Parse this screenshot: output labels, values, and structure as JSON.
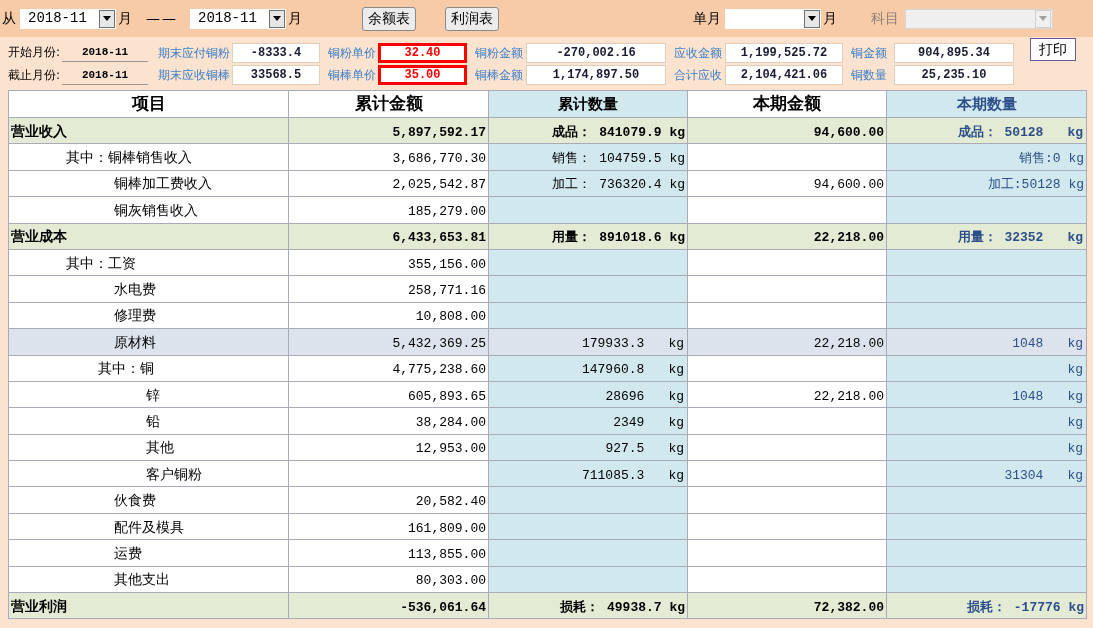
{
  "filter_bar": {
    "from_label": "从",
    "from_month": "2018-11",
    "from_unit": "月",
    "separator": "——",
    "to_month": "2018-11",
    "to_unit": "月",
    "buttons": [
      "余额表",
      "利润表"
    ],
    "single_month_label": "单月",
    "single_month_unit": "月",
    "subject_label": "科目",
    "subject_disabled": true
  },
  "summary": {
    "start_label": "开始月份:",
    "start_value": "2018-11",
    "end_label": "截止月份:",
    "end_value": "2018-11",
    "field_columns": [
      [
        {
          "label": "期末应付铜粉",
          "value": "-8333.4",
          "highlighted": false
        },
        {
          "label": "期末应收铜棒",
          "value": "33568.5",
          "highlighted": false
        }
      ],
      [
        {
          "label": "铜粉单价",
          "value": "32.40",
          "highlighted": true
        },
        {
          "label": "铜棒单价",
          "value": "35.00",
          "highlighted": true
        }
      ],
      [
        {
          "label": "铜粉金额",
          "value": "-270,002.16",
          "highlighted": false
        },
        {
          "label": "铜棒金额",
          "value": "1,174,897.50",
          "highlighted": false
        }
      ],
      [
        {
          "label": "应收金额",
          "value": "1,199,525.72",
          "highlighted": false
        },
        {
          "label": "合计应收",
          "value": "2,104,421.06",
          "highlighted": false
        }
      ],
      [
        {
          "label": "铜金额",
          "value": "904,895.34",
          "highlighted": false
        },
        {
          "label": "铜数量",
          "value": "25,235.10",
          "highlighted": false
        }
      ]
    ],
    "print_button": "打印"
  },
  "table": {
    "columns": [
      "项目",
      "累计金额",
      "累计数量",
      "本期金额",
      "本期数量"
    ],
    "sections": [
      {
        "label": "营业收入",
        "cum_amount": "5,897,592.17",
        "cum_qty": "成品： 841079.9 kg",
        "cur_amount": "94,600.00",
        "cur_qty": "成品： 50128",
        "cur_qty_unit": "kg",
        "children": [
          {
            "prefix": "其中：",
            "label": "铜棒销售收入",
            "cum_amount": "3,686,770.30",
            "cum_qty": "销售： 104759.5 kg",
            "cur_qty": "销售:0 kg"
          },
          {
            "label": "铜棒加工费收入",
            "cum_amount": "2,025,542.87",
            "cum_qty": "加工： 736320.4 kg",
            "cur_amount": "94,600.00",
            "cur_qty": "加工:50128 kg"
          },
          {
            "label": "铜灰销售收入",
            "cum_amount": "185,279.00"
          }
        ]
      },
      {
        "label": "营业成本",
        "cum_amount": "6,433,653.81",
        "cum_qty": "用量： 891018.6 kg",
        "cur_amount": "22,218.00",
        "cur_qty": "用量： 32352",
        "cur_qty_unit": "kg",
        "children": [
          {
            "prefix": "其中：",
            "label": "工资",
            "cum_amount": "355,156.00"
          },
          {
            "label": "水电费",
            "cum_amount": "258,771.16"
          },
          {
            "label": "修理费",
            "cum_amount": "10,808.00"
          },
          {
            "label": "原材料",
            "cum_amount": "5,432,369.25",
            "cum_qty": "179933.3",
            "cum_qty_unit": "kg",
            "cur_amount": "22,218.00",
            "cur_qty": "1048",
            "cur_qty_unit": "kg",
            "children": [
              {
                "prefix": "其中：",
                "label": "铜",
                "cum_amount": "4,775,238.60",
                "cum_qty": "147960.8",
                "cum_qty_unit": "kg",
                "cur_qty_unit": "kg"
              },
              {
                "label": "锌",
                "cum_amount": "605,893.65",
                "cum_qty": "28696",
                "cum_qty_unit": "kg",
                "cur_amount": "22,218.00",
                "cur_qty": "1048",
                "cur_qty_unit": "kg"
              },
              {
                "label": "铅",
                "cum_amount": "38,284.00",
                "cum_qty": "2349",
                "cum_qty_unit": "kg",
                "cur_qty_unit": "kg"
              },
              {
                "label": "其他",
                "cum_amount": "12,953.00",
                "cum_qty": "927.5",
                "cum_qty_unit": "kg",
                "cur_qty_unit": "kg"
              },
              {
                "label": "客户铜粉",
                "cum_qty": "711085.3",
                "cum_qty_unit": "kg",
                "cur_qty": "31304",
                "cur_qty_unit": "kg"
              }
            ]
          },
          {
            "label": "伙食费",
            "cum_amount": "20,582.40"
          },
          {
            "label": "配件及模具",
            "cum_amount": "161,809.00"
          },
          {
            "label": "运费",
            "cum_amount": "113,855.00"
          },
          {
            "label": "其他支出",
            "cum_amount": "80,303.00"
          }
        ]
      },
      {
        "label": "营业利润",
        "cum_amount": "-536,061.64",
        "cum_qty": "损耗： 49938.7 kg",
        "cur_amount": "72,382.00",
        "cur_qty": "损耗： -17776 kg"
      }
    ]
  }
}
